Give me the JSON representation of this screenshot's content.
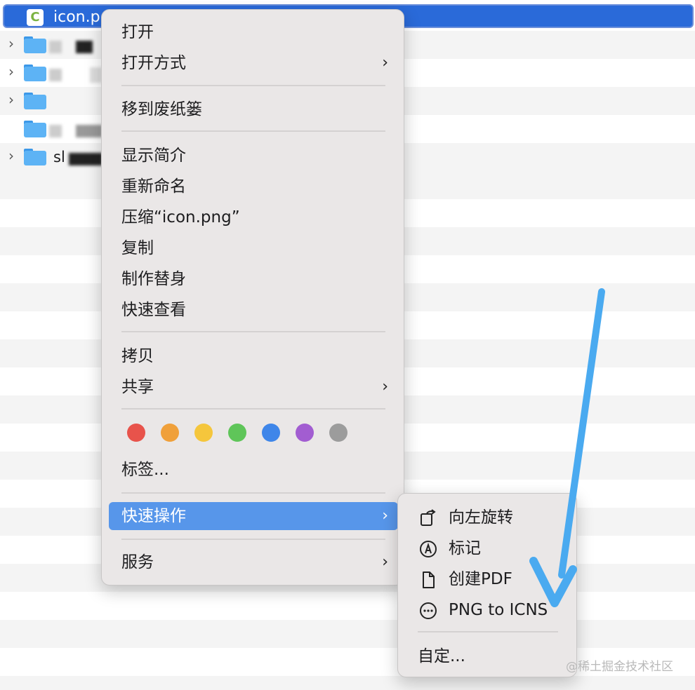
{
  "finder": {
    "selected_file": "icon.p",
    "file_icon_letter": "C",
    "rows": [
      {
        "label": ""
      },
      {
        "label": ""
      },
      {
        "label": ""
      },
      {
        "label": ""
      },
      {
        "label": "sl"
      }
    ]
  },
  "context_menu": {
    "open": "打开",
    "open_with": "打开方式",
    "move_to_trash": "移到废纸篓",
    "get_info": "显示简介",
    "rename": "重新命名",
    "compress": "压缩“icon.png”",
    "duplicate": "复制",
    "make_alias": "制作替身",
    "quick_look": "快速查看",
    "copy": "拷贝",
    "share": "共享",
    "tags": "标签...",
    "quick_actions": "快速操作",
    "services": "服务",
    "submenu_arrow": "›",
    "tag_colors": [
      "#e8534b",
      "#f0a03a",
      "#f5c63c",
      "#5fc559",
      "#3f86e9",
      "#a25dd1",
      "#9c9c9c"
    ]
  },
  "quick_actions_menu": {
    "rotate_left": "向左旋转",
    "markup": "标记",
    "create_pdf": "创建PDF",
    "png_to_icns": "PNG to ICNS",
    "customize": "自定..."
  },
  "watermark": "@稀土掘金技术社区",
  "colors": {
    "selection": "#2a6ad9",
    "menu_highlight": "#5796ea",
    "annotation_arrow": "#4aaaf0"
  }
}
